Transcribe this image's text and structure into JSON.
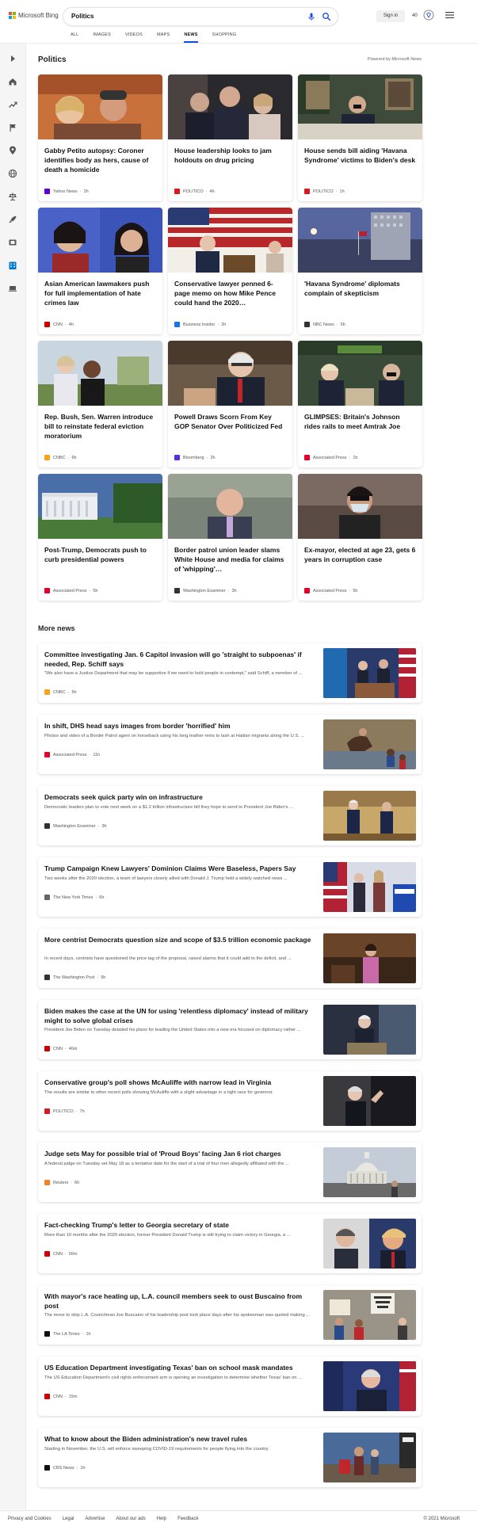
{
  "header": {
    "brand": "Microsoft Bing",
    "query": "Politics",
    "signin_label": "Sign in",
    "rewards_count": "40",
    "brand_colors": [
      "#f25022",
      "#7fba00",
      "#00a4ef",
      "#ffb900"
    ]
  },
  "scopes": [
    "ALL",
    "IMAGES",
    "VIDEOS",
    "MAPS",
    "NEWS",
    "SHOPPING"
  ],
  "active_scope": "NEWS",
  "sidebar_icons": [
    "expand-arrow-icon",
    "home-icon",
    "trending-icon",
    "flag-icon",
    "location-icon",
    "globe-icon",
    "scales-icon",
    "rocket-icon",
    "film-icon",
    "building-icon",
    "laptop-icon"
  ],
  "section": {
    "title": "Politics",
    "powered_by": "Powered by Microsoft News"
  },
  "cards": [
    {
      "title": "Gabby Petito autopsy: Coroner identifies body as hers, cause of death a homicide",
      "source": "Yahoo News",
      "age": "2h",
      "logo_color": "#6001d2"
    },
    {
      "title": "House leadership looks to jam holdouts on drug pricing",
      "source": "POLITICO",
      "age": "4h",
      "logo_color": "#d71920"
    },
    {
      "title": "House sends bill aiding 'Havana Syndrome' victims to Biden's desk",
      "source": "POLITICO",
      "age": "1h",
      "logo_color": "#d71920"
    },
    {
      "title": "Asian American lawmakers push for full implementation of hate crimes law",
      "source": "CNN",
      "age": "4h",
      "logo_color": "#cc0000"
    },
    {
      "title": "Conservative lawyer penned 6-page memo on how Mike Pence could hand the 2020…",
      "source": "Business Insider",
      "age": "2h",
      "logo_color": "#1a73e8"
    },
    {
      "title": "'Havana Syndrome' diplomats complain of skepticism",
      "source": "NBC News",
      "age": "5h",
      "logo_color": "#333333"
    },
    {
      "title": "Rep. Bush, Sen. Warren introduce bill to reinstate federal eviction moratorium",
      "source": "CNBC",
      "age": "6h",
      "logo_color": "#f7a21b"
    },
    {
      "title": "Powell Draws Scorn From Key GOP Senator Over Politicized Fed",
      "source": "Bloomberg",
      "age": "2h",
      "logo_color": "#5a2ee6"
    },
    {
      "title": "GLIMPSES: Britain's Johnson rides rails to meet Amtrak Joe",
      "source": "Associated Press",
      "age": "1h",
      "logo_color": "#e4002b"
    },
    {
      "title": "Post-Trump, Democrats push to curb presidential powers",
      "source": "Associated Press",
      "age": "5h",
      "logo_color": "#e4002b"
    },
    {
      "title": "Border patrol union leader slams White House and media for claims of 'whipping'…",
      "source": "Washington Examiner",
      "age": "3h",
      "logo_color": "#333333"
    },
    {
      "title": "Ex-mayor, elected at age 23, gets 6 years in corruption case",
      "source": "Associated Press",
      "age": "5h",
      "logo_color": "#e4002b"
    }
  ],
  "more_news_title": "More news",
  "news": [
    {
      "title": "Committee investigating Jan. 6 Capitol invasion will go 'straight to subpoenas' if needed, Rep. Schiff says",
      "snippet": "\"We also have a Justice Department that may be supportive if we need to hold people in contempt,\" said Schiff, a member of ...",
      "source": "CNBC",
      "age": "5h",
      "logo_color": "#f7a21b"
    },
    {
      "title": "In shift, DHS head says images from border 'horrified' him",
      "snippet": "Photos and video of a Border Patrol agent on horseback using his long leather reins to lash at Haitian migrants along the U.S. ...",
      "source": "Associated Press",
      "age": "11h",
      "logo_color": "#e4002b"
    },
    {
      "title": "Democrats seek quick party win on infrastructure",
      "snippet": "Democratic leaders plan to vote next week on a $1.2 trillion infrastructure bill they hope to send to President Joe Biden's ...",
      "source": "Washington Examiner",
      "age": "3h",
      "logo_color": "#333333"
    },
    {
      "title": "Trump Campaign Knew Lawyers' Dominion Claims Were Baseless, Papers Say",
      "snippet": "Two weeks after the 2020 election, a team of lawyers closely allied with Donald J. Trump held a widely watched news ...",
      "source": "The New York Times",
      "age": "6h",
      "logo_color": "#666666"
    },
    {
      "title": "More centrist Democrats question size and scope of $3.5 trillion economic package",
      "snippet": "In recent days, centrists have questioned the price tag of the proposal, raised alarms that it could add to the deficit, and ...",
      "source": "The Washington Post",
      "age": "9h",
      "logo_color": "#333333"
    },
    {
      "title": "Biden makes the case at the UN for using 'relentless diplomacy' instead of military might to solve global crises",
      "snippet": "President Joe Biden on Tuesday detailed his plans for leading the United States into a new era focused on diplomacy rather ...",
      "source": "CNN",
      "age": "46m",
      "logo_color": "#cc0000"
    },
    {
      "title": "Conservative group's poll shows McAuliffe with narrow lead in Virginia",
      "snippet": "The results are similar to other recent polls showing McAuliffe with a slight advantage in a tight race for governor.",
      "source": "POLITICO",
      "age": "7h",
      "logo_color": "#d71920"
    },
    {
      "title": "Judge sets May for possible trial of 'Proud Boys' facing Jan 6 riot charges",
      "snippet": "A federal judge on Tuesday set May 18 as a tentative date for the start of a trial of four men allegedly affiliated with the ...",
      "source": "Reuters",
      "age": "6h",
      "logo_color": "#f58220"
    },
    {
      "title": "Fact-checking Trump's letter to Georgia secretary of state",
      "snippet": "More than 10 months after the 2020 election, former President Donald Trump is still trying to claim victory in Georgia, a ...",
      "source": "CNN",
      "age": "56m",
      "logo_color": "#cc0000"
    },
    {
      "title": "With mayor's race heating up, L.A. council members seek to oust Buscaino from post",
      "snippet": "The move to strip L.A. Councilman Joe Buscaino of his leadership post took place days after his spokesman was quoted making ...",
      "source": "The LA Times",
      "age": "1h",
      "logo_color": "#111111"
    },
    {
      "title": "US Education Department investigating Texas' ban on school mask mandates",
      "snippet": "The US Education Department's civil rights enforcement arm is opening an investigation to determine whether Texas' ban on ...",
      "source": "CNN",
      "age": "15m",
      "logo_color": "#cc0000"
    },
    {
      "title": "What to know about the Biden administration's new travel rules",
      "snippet": "Starting in November, the U.S. will enforce sweeping COVID-19 requirements for people flying into the country.",
      "source": "CBS News",
      "age": "1h",
      "logo_color": "#111111"
    }
  ],
  "footer": {
    "links": [
      "Privacy and Cookies",
      "Legal",
      "Advertise",
      "About our ads",
      "Help",
      "Feedback"
    ],
    "copyright": "© 2021 Microsoft"
  }
}
